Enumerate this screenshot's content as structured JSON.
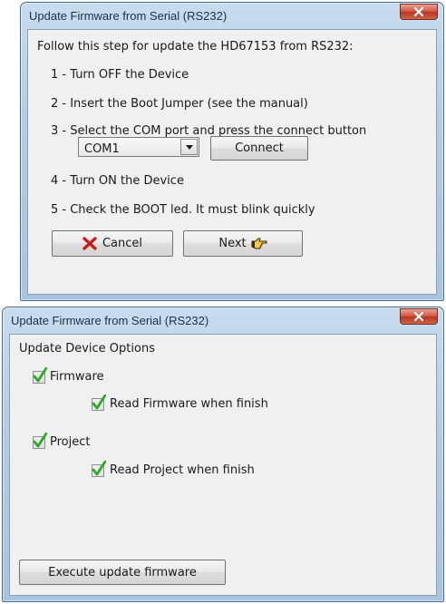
{
  "dialog1": {
    "title": "Update Firmware from Serial (RS232)",
    "intro": "Follow this step for update the HD67153 from RS232:",
    "steps": [
      "1 - Turn OFF the Device",
      "2 - Insert the Boot Jumper (see the manual)",
      "3 - Select the  COM port and press the connect button",
      "4 - Turn ON the Device",
      "5 - Check the BOOT led. It must blink quickly"
    ],
    "com_port_value": "COM1",
    "connect_label": "Connect",
    "cancel_label": "Cancel",
    "next_label": "Next",
    "icons": {
      "close": "close-icon",
      "cancel": "red-x-icon",
      "next": "pointing-hand-icon",
      "dropdown": "chevron-down-icon"
    }
  },
  "dialog2": {
    "title": "Update Firmware from Serial (RS232)",
    "section_label": "Update Device Options",
    "options": [
      {
        "label": "Firmware",
        "checked": true
      },
      {
        "label": "Read Firmware when finish",
        "checked": true
      },
      {
        "label": "Project",
        "checked": true
      },
      {
        "label": "Read Project when finish",
        "checked": true
      }
    ],
    "execute_label": "Execute update firmware",
    "icons": {
      "close": "close-icon",
      "check": "green-check-icon"
    }
  },
  "colors": {
    "frame": "#b4cde4",
    "client": "#f0f0f0",
    "close_button": "#c9442e",
    "check_green": "#2fa82a",
    "cancel_red": "#c41f1f"
  }
}
